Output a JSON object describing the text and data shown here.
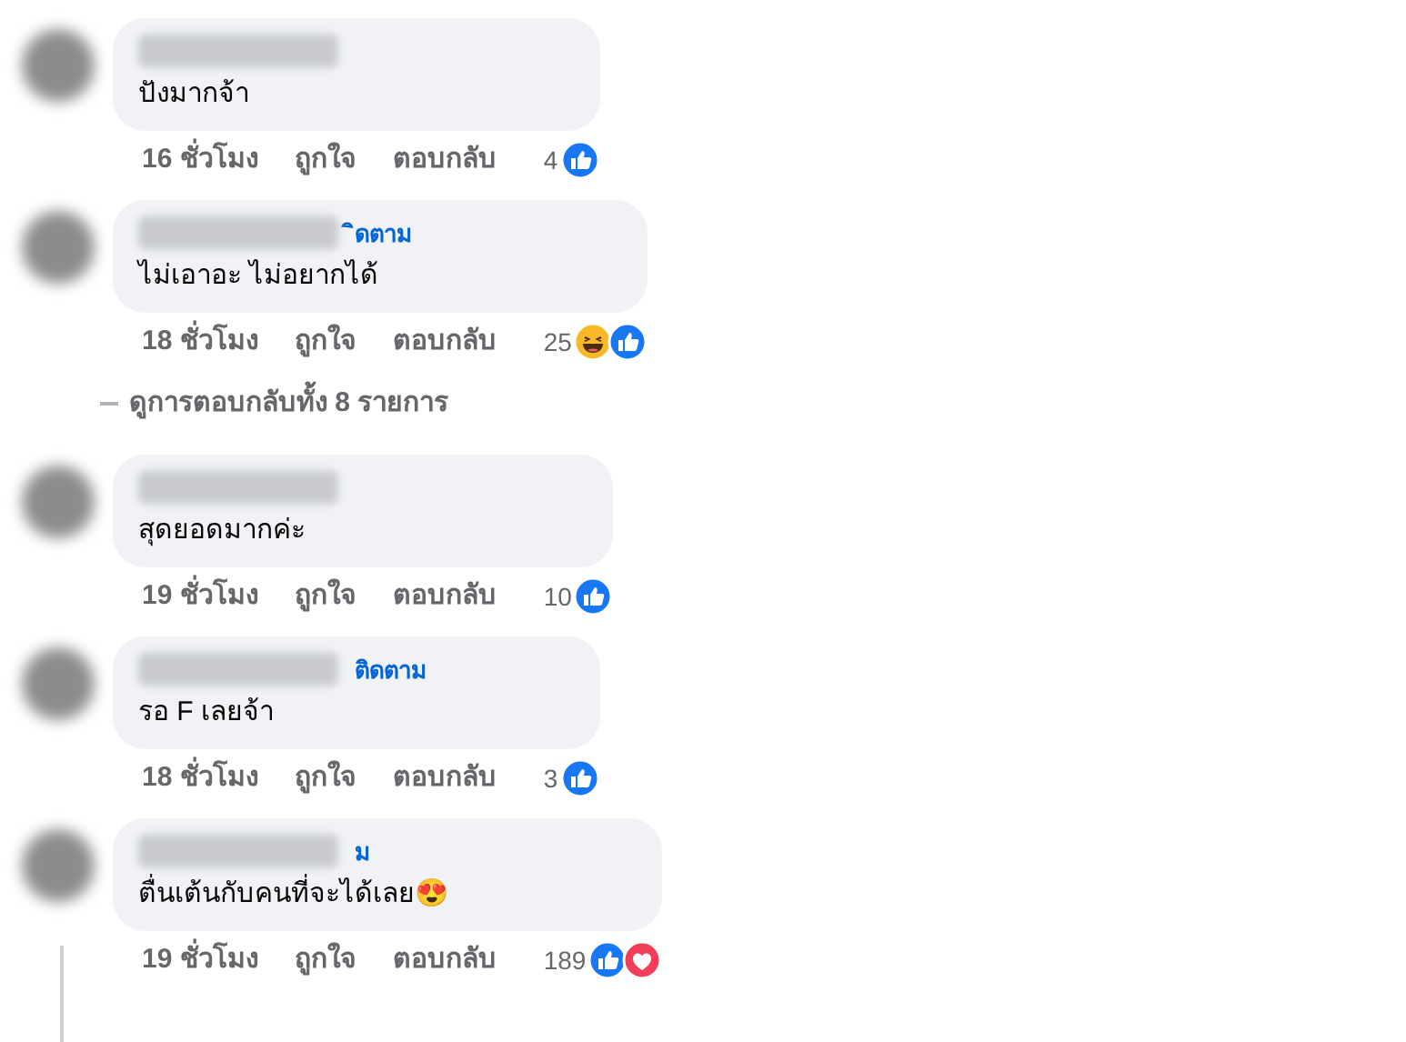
{
  "comments": [
    {
      "text": "ปังมากจ้า",
      "time": "16 ชั่วโมง",
      "like": "ถูกใจ",
      "reply": "ตอบกลับ",
      "count": "4",
      "reactions": [
        {
          "kind": "like"
        }
      ]
    },
    {
      "follow": "ิดตาม",
      "text": "ไม่เอาอะ ไม่อยากได้",
      "time": "18 ชั่วโมง",
      "like": "ถูกใจ",
      "reply": "ตอบกลับ",
      "count": "25",
      "reactions": [
        {
          "kind": "haha"
        },
        {
          "kind": "like"
        }
      ],
      "more": "ดูการตอบกลับทั้ง 8 รายการ"
    },
    {
      "text": "สุดยอดมากค่ะ",
      "time": "19 ชั่วโมง",
      "like": "ถูกใจ",
      "reply": "ตอบกลับ",
      "count": "10",
      "reactions": [
        {
          "kind": "like"
        }
      ]
    },
    {
      "follow": "ติดตาม",
      "text": "รอ F เลยจ้า",
      "time": "18 ชั่วโมง",
      "like": "ถูกใจ",
      "reply": "ตอบกลับ",
      "count": "3",
      "reactions": [
        {
          "kind": "like"
        }
      ]
    },
    {
      "follow": "ม",
      "text": "ตื่นเต้นกับคนที่จะได้เลย😍",
      "time": "19 ชั่วโมง",
      "like": "ถูกใจ",
      "reply": "ตอบกลับ",
      "count": "189",
      "reactions": [
        {
          "kind": "like"
        },
        {
          "kind": "love"
        }
      ]
    }
  ]
}
